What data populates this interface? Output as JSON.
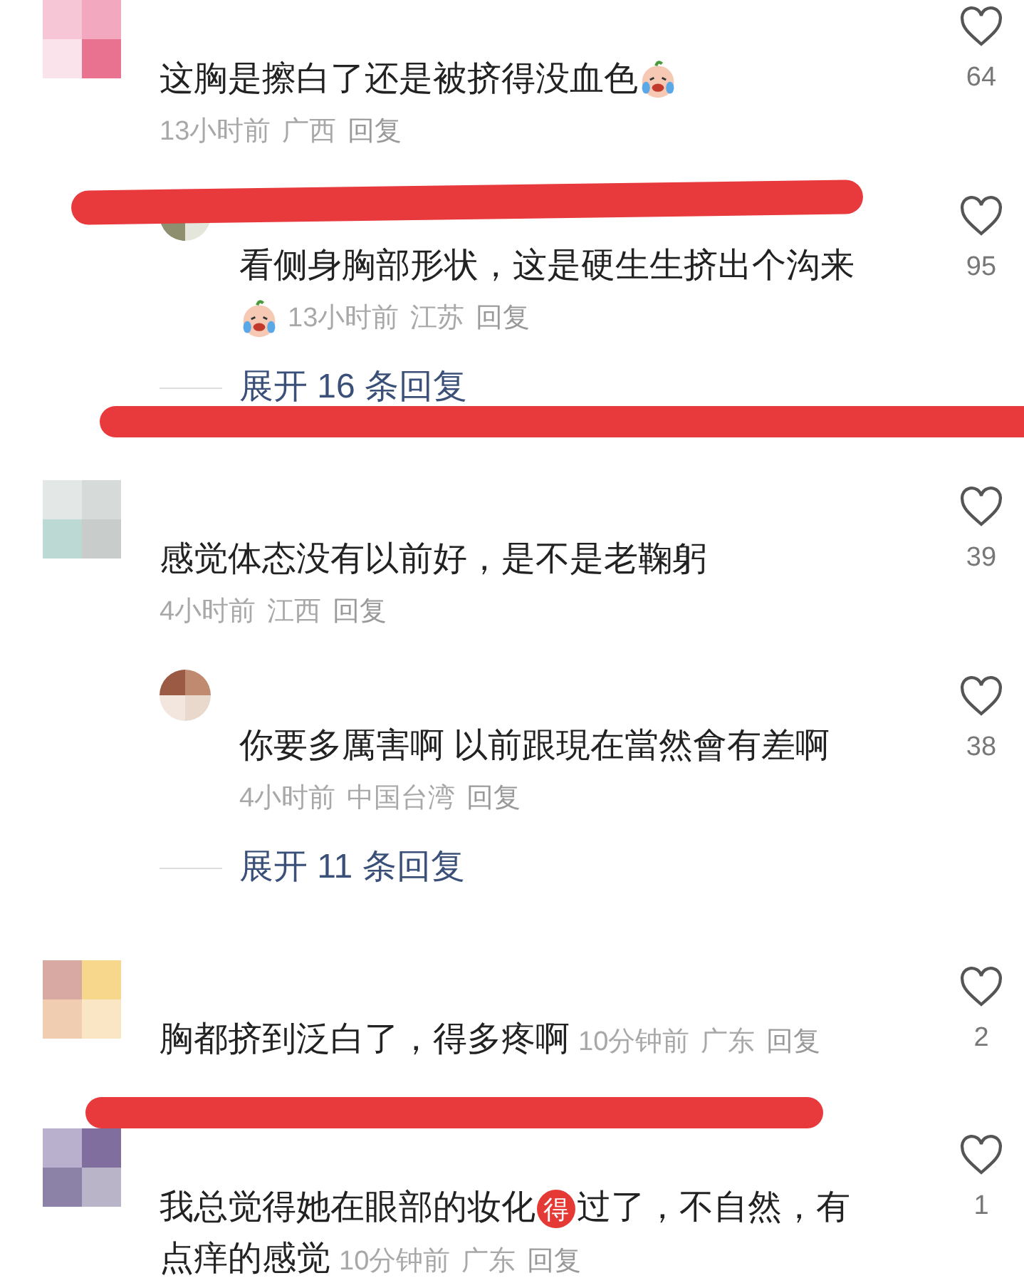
{
  "comments": [
    {
      "kind": "stacked",
      "text_parts": [
        {
          "kind": "text",
          "text": "这胸是擦白了还是被挤得没血色"
        }
      ],
      "text_emoji": true,
      "meta_emoji": false,
      "time": "13小时前",
      "region": "广西",
      "reply_label": "回复",
      "likes": "64",
      "replies": [
        {
          "text_parts": [
            {
              "kind": "text",
              "text": "看侧身胸部形状，这是硬生生挤出个沟来"
            }
          ],
          "text_emoji": false,
          "meta_emoji": true,
          "time": "13小时前",
          "region": "江苏",
          "reply_label": "回复",
          "likes": "95"
        }
      ],
      "expand": "展开 16 条回复"
    },
    {
      "kind": "stacked",
      "text_parts": [
        {
          "kind": "text",
          "text": "感觉体态没有以前好，是不是老鞠躬"
        }
      ],
      "text_emoji": false,
      "meta_emoji": false,
      "time": "4小时前",
      "region": "江西",
      "reply_label": "回复",
      "likes": "39",
      "replies": [
        {
          "text_parts": [
            {
              "kind": "text",
              "text": "你要多厲害啊 以前跟現在當然會有差啊"
            }
          ],
          "text_emoji": false,
          "meta_emoji": false,
          "time": "4小时前",
          "region": "中国台湾",
          "reply_label": "回复",
          "likes": "38"
        }
      ],
      "expand": "展开 11 条回复"
    },
    {
      "kind": "inline",
      "text_parts": [
        {
          "kind": "text",
          "text": "胸都挤到泛白了，得多疼啊"
        }
      ],
      "text_emoji": false,
      "meta_emoji": false,
      "time": "10分钟前",
      "region": "广东",
      "reply_label": "回复",
      "likes": "2"
    },
    {
      "kind": "inline",
      "text_parts": [
        {
          "kind": "text",
          "text": "我总觉得她在眼部的妆化"
        },
        {
          "kind": "badge",
          "text": "得"
        },
        {
          "kind": "text",
          "text": "过了，不自然，有"
        },
        {
          "kind": "break"
        },
        {
          "kind": "text",
          "text": "点痒的感觉"
        }
      ],
      "text_emoji": false,
      "meta_emoji": false,
      "time": "10分钟前",
      "region": "广东",
      "reply_label": "回复",
      "likes": "1"
    }
  ]
}
